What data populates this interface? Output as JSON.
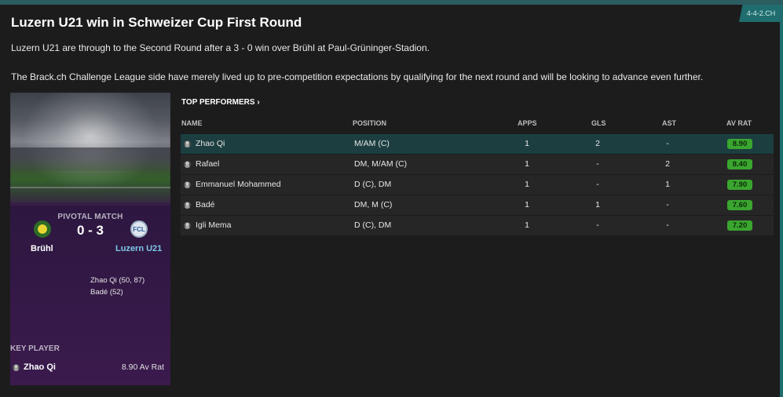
{
  "header": {
    "tag": "4-4-2.CH",
    "title": "Luzern U21 win in Schweizer Cup First Round",
    "paragraph1": "Luzern U21 are through to the Second Round after a 3 - 0 win over Brühl at Paul-Grüninger-Stadion.",
    "paragraph2": "The Brack.ch Challenge League side have merely lived up to pre-competition expectations by qualifying for the next round and will be looking to advance even further."
  },
  "pivotal_match": {
    "label": "PIVOTAL MATCH",
    "score": "0 - 3",
    "home_team": "Brühl",
    "away_team": "Luzern U21",
    "away_crest_text": "FCL",
    "scorers": [
      "Zhao Qi (50, 87)",
      "Badé (52)"
    ]
  },
  "key_player": {
    "label": "KEY PLAYER",
    "name": "Zhao Qi",
    "rating": "8.90 Av Rat"
  },
  "top_performers": {
    "title": "TOP PERFORMERS ›",
    "columns": {
      "name": "NAME",
      "position": "POSITION",
      "apps": "APPS",
      "gls": "GLS",
      "ast": "AST",
      "av_rat": "AV RAT"
    },
    "rows": [
      {
        "name": "Zhao Qi",
        "position": "M/AM (C)",
        "apps": "1",
        "gls": "2",
        "ast": "-",
        "rating": "8.90"
      },
      {
        "name": "Rafael",
        "position": "DM, M/AM (C)",
        "apps": "1",
        "gls": "-",
        "ast": "2",
        "rating": "8.40"
      },
      {
        "name": "Emmanuel Mohammed",
        "position": "D (C), DM",
        "apps": "1",
        "gls": "-",
        "ast": "1",
        "rating": "7.90"
      },
      {
        "name": "Badé",
        "position": "DM, M (C)",
        "apps": "1",
        "gls": "1",
        "ast": "-",
        "rating": "7.60"
      },
      {
        "name": "Igli Mema",
        "position": "D (C), DM",
        "apps": "1",
        "gls": "-",
        "ast": "-",
        "rating": "7.20"
      }
    ]
  },
  "colors": {
    "accent": "#1f6d6f",
    "rating_good": "#3aa52f",
    "selected_row": "#1c3e40",
    "card_purple": "#3a1f4a"
  }
}
